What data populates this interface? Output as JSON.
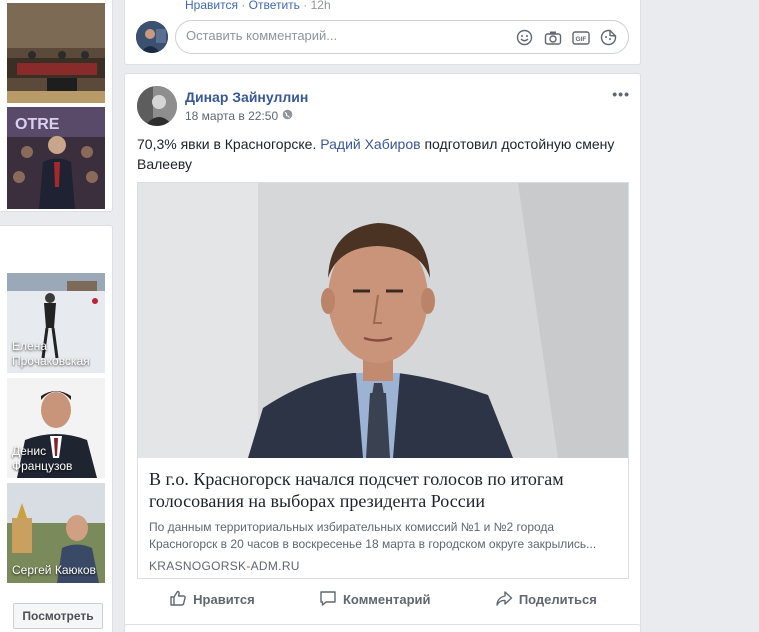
{
  "left_column": {
    "people": [
      {
        "name": "Елена Прочаковская",
        "name_lines": [
          "Елена",
          "Прочаковская"
        ]
      },
      {
        "name": "Денис Французов",
        "name_lines": [
          "Денис",
          "Французов"
        ]
      },
      {
        "name": "Сергей Каюков",
        "name_lines": [
          "Сергей Каюков"
        ]
      }
    ],
    "see_button": "Посмотреть"
  },
  "previous_comment": {
    "like": "Нравится",
    "separator": " · ",
    "reply": "Ответить",
    "time": "12h"
  },
  "comment_box": {
    "placeholder": "Оставить комментарий...",
    "icons": [
      "emoji-icon",
      "camera-icon",
      "gif-icon",
      "sticker-icon"
    ]
  },
  "post": {
    "author": "Динар Зайнуллин",
    "time": "18 марта в 22:50",
    "text_before": "70,3% явки в Красногорске. ",
    "mention": "Радий Хабиров",
    "text_after": " подготовил достойную смену Валееву",
    "link": {
      "title": "В г.о. Красногорск начался подсчет голосов по итогам голосования на выборах президента России",
      "description": "По данным территориальных избирательных комиссий №1 и №2 города Красногорск в 20 часов в воскресенье 18 марта в городском округе закрылись...",
      "domain": "KRASNOGORSK-ADM.RU"
    },
    "actions": {
      "like": "Нравится",
      "comment": "Комментарий",
      "share": "Поделиться"
    }
  },
  "colors": {
    "background": "#e9ebee",
    "link_blue": "#385898",
    "secondary_text": "#606770"
  }
}
